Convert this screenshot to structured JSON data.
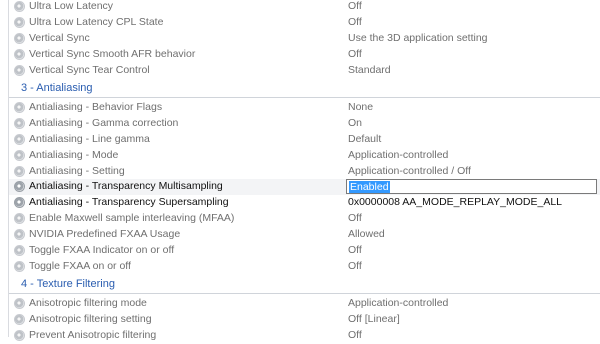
{
  "rows_top": [
    {
      "name": "Ultra Low Latency",
      "value": "Off"
    },
    {
      "name": "Ultra Low Latency CPL State",
      "value": "Off"
    },
    {
      "name": "Vertical Sync",
      "value": "Use the 3D application setting"
    },
    {
      "name": "Vertical Sync Smooth AFR behavior",
      "value": "Off"
    },
    {
      "name": "Vertical Sync Tear Control",
      "value": "Standard"
    }
  ],
  "section_aa": {
    "label": "3 - Antialiasing"
  },
  "rows_aa": [
    {
      "name": "Antialiasing - Behavior Flags",
      "value": "None"
    },
    {
      "name": "Antialiasing - Gamma correction",
      "value": "On"
    },
    {
      "name": "Antialiasing - Line gamma",
      "value": "Default"
    },
    {
      "name": "Antialiasing - Mode",
      "value": "Application-controlled"
    },
    {
      "name": "Antialiasing - Setting",
      "value": "Application-controlled / Off"
    },
    {
      "name": "Antialiasing - Transparency Multisampling",
      "value": "Enabled"
    },
    {
      "name": "Antialiasing - Transparency Supersampling",
      "value": "0x0000008 AA_MODE_REPLAY_MODE_ALL"
    },
    {
      "name": "Enable Maxwell sample interleaving (MFAA)",
      "value": "Off"
    },
    {
      "name": "NVIDIA Predefined FXAA Usage",
      "value": "Allowed"
    },
    {
      "name": "Toggle FXAA Indicator on or off",
      "value": "Off"
    },
    {
      "name": "Toggle FXAA on or off",
      "value": "Off"
    }
  ],
  "section_tf": {
    "label": "4 - Texture Filtering"
  },
  "rows_tf": [
    {
      "name": "Anisotropic filtering mode",
      "value": "Application-controlled"
    },
    {
      "name": "Anisotropic filtering setting",
      "value": "Off [Linear]"
    },
    {
      "name": "Prevent Anisotropic filtering",
      "value": "Off"
    }
  ],
  "colors": {
    "section_text": "#2a5db0",
    "selection": "#3399ff"
  },
  "icon": "gear-radio-icon"
}
